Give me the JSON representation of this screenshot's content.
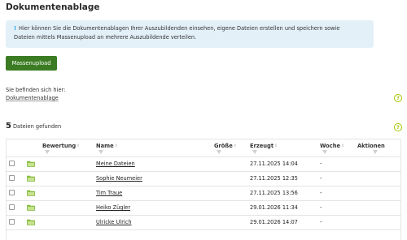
{
  "page": {
    "title": "Dokumentenablage",
    "info_text_line1": "Hier können Sie die Dokumentenablagen Ihrer Auszubildenden einsehen, eigene Dateien erstellen und speichern sowie",
    "info_text_line2": "Dateien mittels Massenupload an mehrere Auszubildende verteilen.",
    "info_icon": "!",
    "mass_upload_label": "Massenupload",
    "location_label": "Sie befinden sich hier:",
    "breadcrumb": "Dokumentenablage",
    "help_icon": "?",
    "file_count": "5",
    "file_count_label": "Dateien gefunden"
  },
  "table": {
    "columns": {
      "rating": "Bewertung",
      "name": "Name",
      "size": "Größe",
      "created": "Erzeugt",
      "week": "Woche",
      "actions": "Aktionen"
    },
    "sort_glyph": "⇕",
    "rows": [
      {
        "name": "Meine Dateien",
        "created": "27.11.2025 14:04",
        "week": "-"
      },
      {
        "name": "Sophie Neumeier",
        "created": "27.11.2025 12:35",
        "week": "-"
      },
      {
        "name": "Tim Traue",
        "created": "27.11.2025 13:56",
        "week": "-"
      },
      {
        "name": "Heiko Zügler",
        "created": "29.01.2026 11:34",
        "week": "-"
      },
      {
        "name": "Ulricke Ulrich",
        "created": "29.01.2026 14:07",
        "week": "-"
      }
    ]
  },
  "colors": {
    "primary_green": "#3b7c23",
    "help_green": "#a6c400",
    "folder_green": "#8dc63f",
    "info_background": "#e3f0f8",
    "info_accent": "#1aa0d8"
  },
  "icons": {
    "folder": "folder-icon",
    "help": "help-icon",
    "info": "info-icon",
    "filter": "filter-icon",
    "sort": "sort-icon"
  }
}
